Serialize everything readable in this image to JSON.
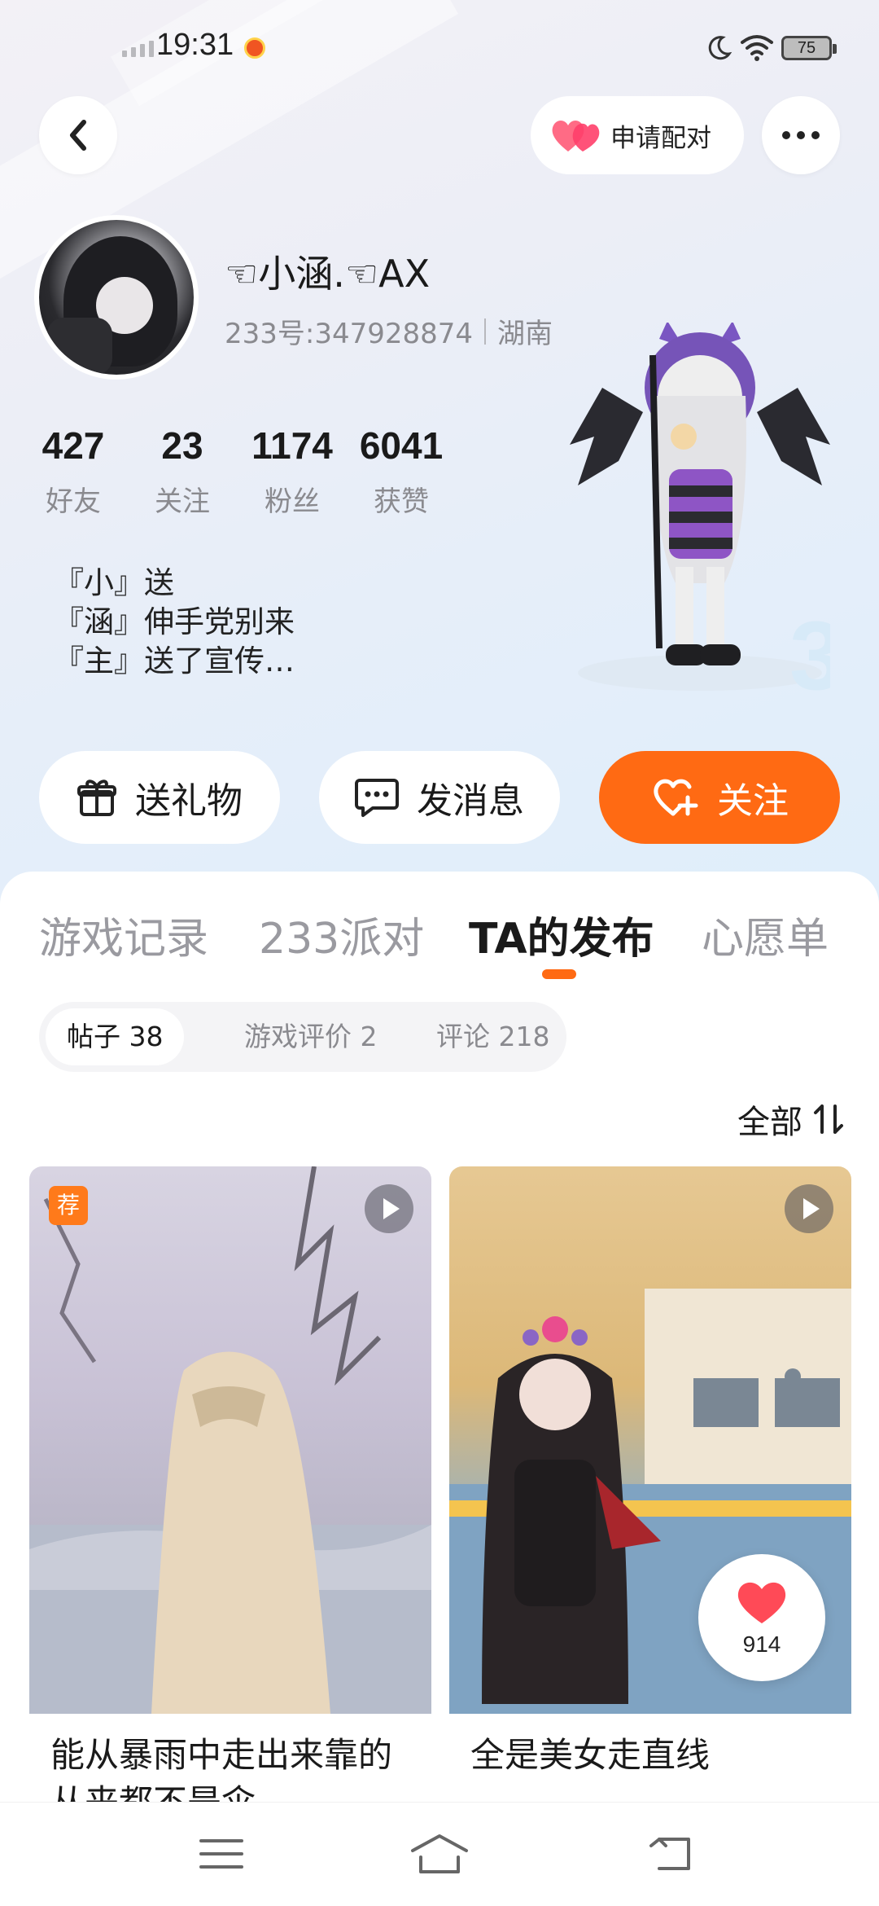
{
  "status_bar": {
    "time": "19:31",
    "battery_level": "75"
  },
  "header": {
    "pair_button_label": "申请配对"
  },
  "profile": {
    "username": "☜小涵.☜AX",
    "id_text": "233号:347928874",
    "location": "湖南",
    "stats": [
      {
        "value": "427",
        "label": "好友"
      },
      {
        "value": "23",
        "label": "关注"
      },
      {
        "value": "1174",
        "label": "粉丝"
      },
      {
        "value": "6041",
        "label": "获赞"
      }
    ],
    "bio_lines": [
      "『小』送",
      "『涵』伸手党别来",
      "『主』送了宣传…"
    ]
  },
  "actions": {
    "gift_label": "送礼物",
    "message_label": "发消息",
    "follow_label": "关注"
  },
  "tabs": [
    "游戏记录",
    "233派对",
    "TA的发布",
    "心愿单"
  ],
  "active_tab": "TA的发布",
  "subtabs": [
    "帖子 38",
    "游戏评价 2",
    "评论 218"
  ],
  "sort_label": "全部",
  "posts": [
    {
      "badge": "荐",
      "title": "能从暴雨中走出来靠的从来都不是伞"
    },
    {
      "title": "全是美女走直线",
      "likes": "914"
    }
  ],
  "colors": {
    "accent": "#ff6a13",
    "heart": "#ff4a57"
  },
  "icons": {
    "back": "back-arrow-icon",
    "more": "more-dots-icon",
    "pair": "heart-pair-icon",
    "gift": "gift-icon",
    "message": "message-icon",
    "follow": "heart-plus-icon",
    "sort": "sort-icon",
    "nav_menu": "menu-icon",
    "nav_home": "home-icon",
    "nav_back": "back-icon"
  }
}
